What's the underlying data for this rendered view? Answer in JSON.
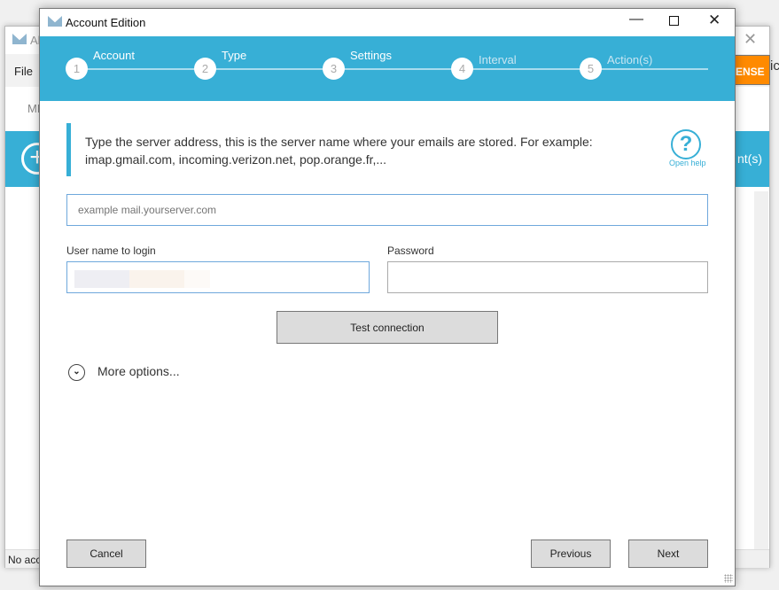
{
  "background_window": {
    "title": "Al",
    "menu_file": "File",
    "tab_partial": "ME",
    "license_button": "ENSE",
    "right_text": "ic",
    "blue_band_text": "nt(s)",
    "status": "No acc"
  },
  "dialog": {
    "title": "Account Edition",
    "steps": [
      {
        "num": "1",
        "label": "Account"
      },
      {
        "num": "2",
        "label": "Type"
      },
      {
        "num": "3",
        "label": "Settings"
      },
      {
        "num": "4",
        "label": "Interval"
      },
      {
        "num": "5",
        "label": "Action(s)"
      }
    ],
    "info_text_line1": "Type the server address, this is the server name where your emails are stored. For example:",
    "info_text_line2": "imap.gmail.com, incoming.verizon.net, pop.orange.fr,...",
    "help_label": "Open help",
    "server": {
      "placeholder": "example mail.yourserver.com",
      "value": ""
    },
    "username": {
      "label": "User name to login",
      "value": "[redacted]"
    },
    "password": {
      "label": "Password",
      "value": ""
    },
    "test_connection": "Test connection",
    "more_options": "More options...",
    "cancel": "Cancel",
    "previous": "Previous",
    "next": "Next"
  },
  "colors": {
    "accent": "#37afd6",
    "license": "#ff8a00"
  }
}
